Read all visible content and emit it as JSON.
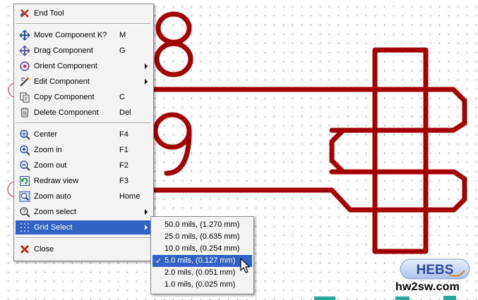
{
  "menu": {
    "items": [
      {
        "label": "End Tool",
        "shortcut": "",
        "icon": "end-tool-icon"
      },
      {
        "label": "Move Component K?",
        "shortcut": "M",
        "icon": "move-icon"
      },
      {
        "label": "Drag Component",
        "shortcut": "G",
        "icon": "drag-icon"
      },
      {
        "label": "Orient Component",
        "shortcut": "",
        "icon": "orient-icon",
        "submenu": true
      },
      {
        "label": "Edit Component",
        "shortcut": "",
        "icon": "edit-icon",
        "submenu": true
      },
      {
        "label": "Copy Component",
        "shortcut": "C",
        "icon": "copy-icon"
      },
      {
        "label": "Delete Component",
        "shortcut": "Del",
        "icon": "delete-icon"
      },
      {
        "label": "Center",
        "shortcut": "F4",
        "icon": "center-icon"
      },
      {
        "label": "Zoom in",
        "shortcut": "F1",
        "icon": "zoom-in-icon"
      },
      {
        "label": "Zoom out",
        "shortcut": "F2",
        "icon": "zoom-out-icon"
      },
      {
        "label": "Redraw view",
        "shortcut": "F3",
        "icon": "redraw-icon"
      },
      {
        "label": "Zoom auto",
        "shortcut": "Home",
        "icon": "zoom-auto-icon"
      },
      {
        "label": "Zoom select",
        "shortcut": "",
        "icon": "zoom-select-icon",
        "submenu": true
      },
      {
        "label": "Grid Select",
        "shortcut": "",
        "icon": "grid-icon",
        "submenu": true,
        "active": true
      },
      {
        "label": "Close",
        "shortcut": "",
        "icon": "close-icon"
      }
    ]
  },
  "grid_submenu": {
    "items": [
      {
        "label": "50.0 mils, (1.270 mm)"
      },
      {
        "label": "25.0 mils, (0.635 mm)"
      },
      {
        "label": "10.0 mils, (0.254 mm)"
      },
      {
        "label": "5.0 mils, (0.127 mm)",
        "selected": true
      },
      {
        "label": "2.0 mils, (0.051 mm)"
      },
      {
        "label": "1.0 mils, (0.025 mm)"
      }
    ],
    "check_mark": "✓"
  },
  "canvas": {
    "digits": [
      "8",
      "9"
    ],
    "trace_color": "#a30000"
  },
  "logo": {
    "badge_text": "HEBS",
    "url": "hw2sw.com"
  }
}
